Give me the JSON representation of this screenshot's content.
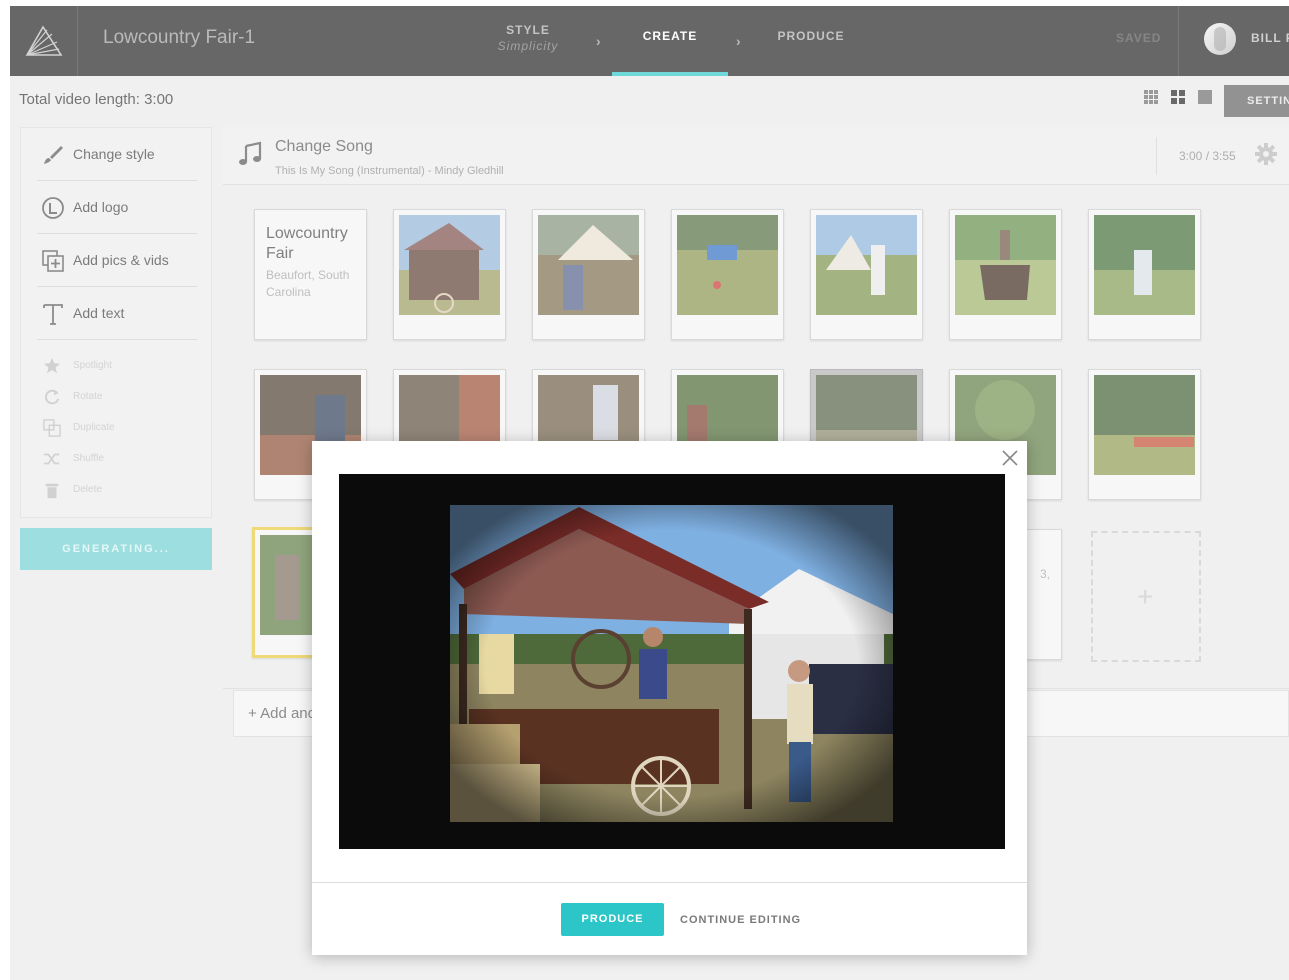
{
  "header": {
    "project_title": "Lowcountry Fair-1",
    "steps": [
      {
        "label": "STYLE",
        "sub": "Simplicity"
      },
      {
        "label": "CREATE"
      },
      {
        "label": "PRODUCE"
      }
    ],
    "saved_label": "SAVED",
    "user_name": "BILL F"
  },
  "subbar": {
    "length_label": "Total video length: 3:00",
    "settings_label": "SETTINGS"
  },
  "tools": {
    "primary": [
      {
        "label": "Change style",
        "icon": "brush-icon"
      },
      {
        "label": "Add logo",
        "icon": "logo-icon"
      },
      {
        "label": "Add pics & vids",
        "icon": "add-media-icon"
      },
      {
        "label": "Add text",
        "icon": "text-icon"
      }
    ],
    "secondary": [
      {
        "label": "Spotlight",
        "icon": "star-icon"
      },
      {
        "label": "Rotate",
        "icon": "rotate-icon"
      },
      {
        "label": "Duplicate",
        "icon": "duplicate-icon"
      },
      {
        "label": "Shuffle",
        "icon": "shuffle-icon"
      },
      {
        "label": "Delete",
        "icon": "trash-icon"
      }
    ],
    "generating_label": "GENERATING..."
  },
  "song": {
    "title": "Change Song",
    "subtitle": "This Is My Song (Instrumental) - Mindy Gledhill",
    "time": "3:00 / 3:55"
  },
  "storyboard": {
    "title_card": {
      "title": "Lowcountry Fair",
      "subtitle": "Beaufort, South Carolina"
    },
    "partial_text": "3,",
    "add_another_label": "+ Add another"
  },
  "modal": {
    "produce_label": "PRODUCE",
    "continue_label": "CONTINUE EDITING"
  },
  "colors": {
    "accent": "#2cc6c8",
    "topbar": "#1f1f1f",
    "selected_border": "#e8c83a"
  }
}
